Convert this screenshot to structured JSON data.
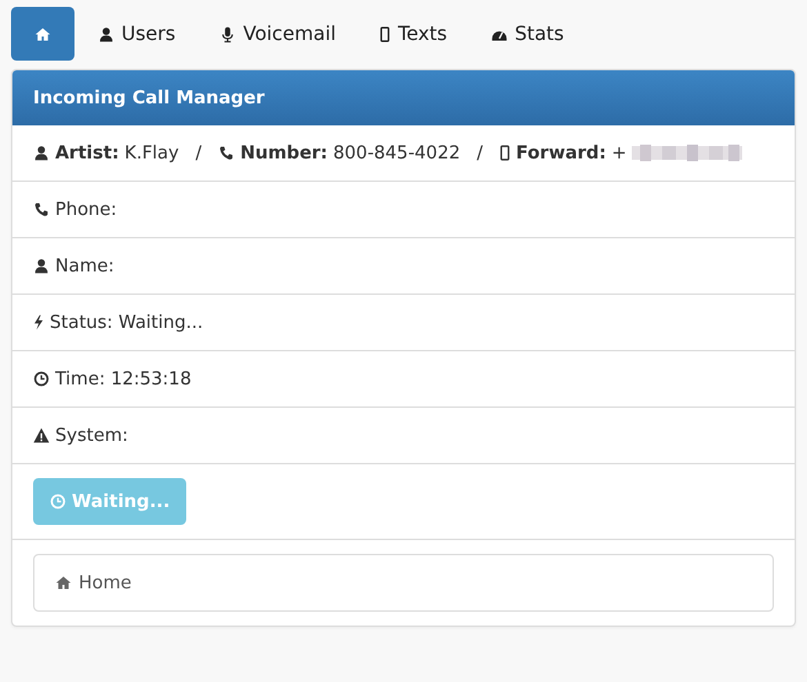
{
  "tabs": [
    {
      "selected": true
    },
    {
      "label": "Users",
      "selected": false
    },
    {
      "label": "Voicemail",
      "selected": false
    },
    {
      "label": "Texts",
      "selected": false
    },
    {
      "label": "Stats",
      "selected": false
    }
  ],
  "panel": {
    "title": "Incoming Call Manager",
    "summary": [
      {
        "label": "Artist:",
        "value": "K.Flay"
      },
      {
        "label": "Number:",
        "value": "800-845-4022"
      },
      {
        "label": "Forward:",
        "value": "+",
        "redacted": true
      }
    ],
    "separator": "/",
    "rows": [
      {
        "text": "Phone:"
      },
      {
        "text": "Name:"
      },
      {
        "text": "Status: Waiting..."
      },
      {
        "text": "Time: 12:53:18"
      },
      {
        "text": "System:"
      }
    ],
    "button": {
      "label": "Waiting...",
      "disabled": true
    },
    "breadcrumb": "Home"
  }
}
